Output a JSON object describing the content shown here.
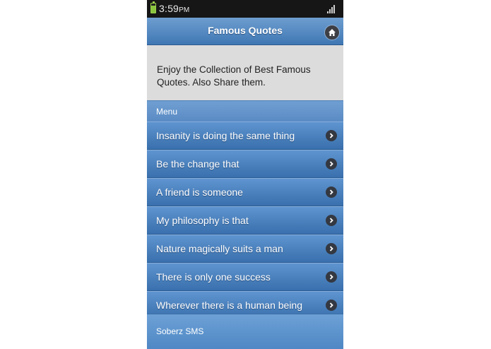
{
  "status_bar": {
    "time": "3:59",
    "ampm": "PM",
    "battery_icon": "battery-icon",
    "signal_icon": "signal-icon"
  },
  "header": {
    "title": "Famous Quotes",
    "home_icon": "home-icon"
  },
  "intro": {
    "text": "Enjoy the Collection of Best Famous Quotes. Also Share them."
  },
  "menu": {
    "label": "Menu",
    "items": [
      {
        "label": "Insanity is doing the same thing"
      },
      {
        "label": "Be the change that"
      },
      {
        "label": "A friend is someone"
      },
      {
        "label": "My philosophy is that"
      },
      {
        "label": "Nature magically suits a man"
      },
      {
        "label": "There is only one success"
      },
      {
        "label": "Wherever there is a human being"
      }
    ]
  },
  "footer": {
    "text": "Soberz SMS"
  },
  "colors": {
    "accent": "#3f77b3",
    "statusbar": "#161616",
    "intro_bg": "#dcdcdc"
  }
}
